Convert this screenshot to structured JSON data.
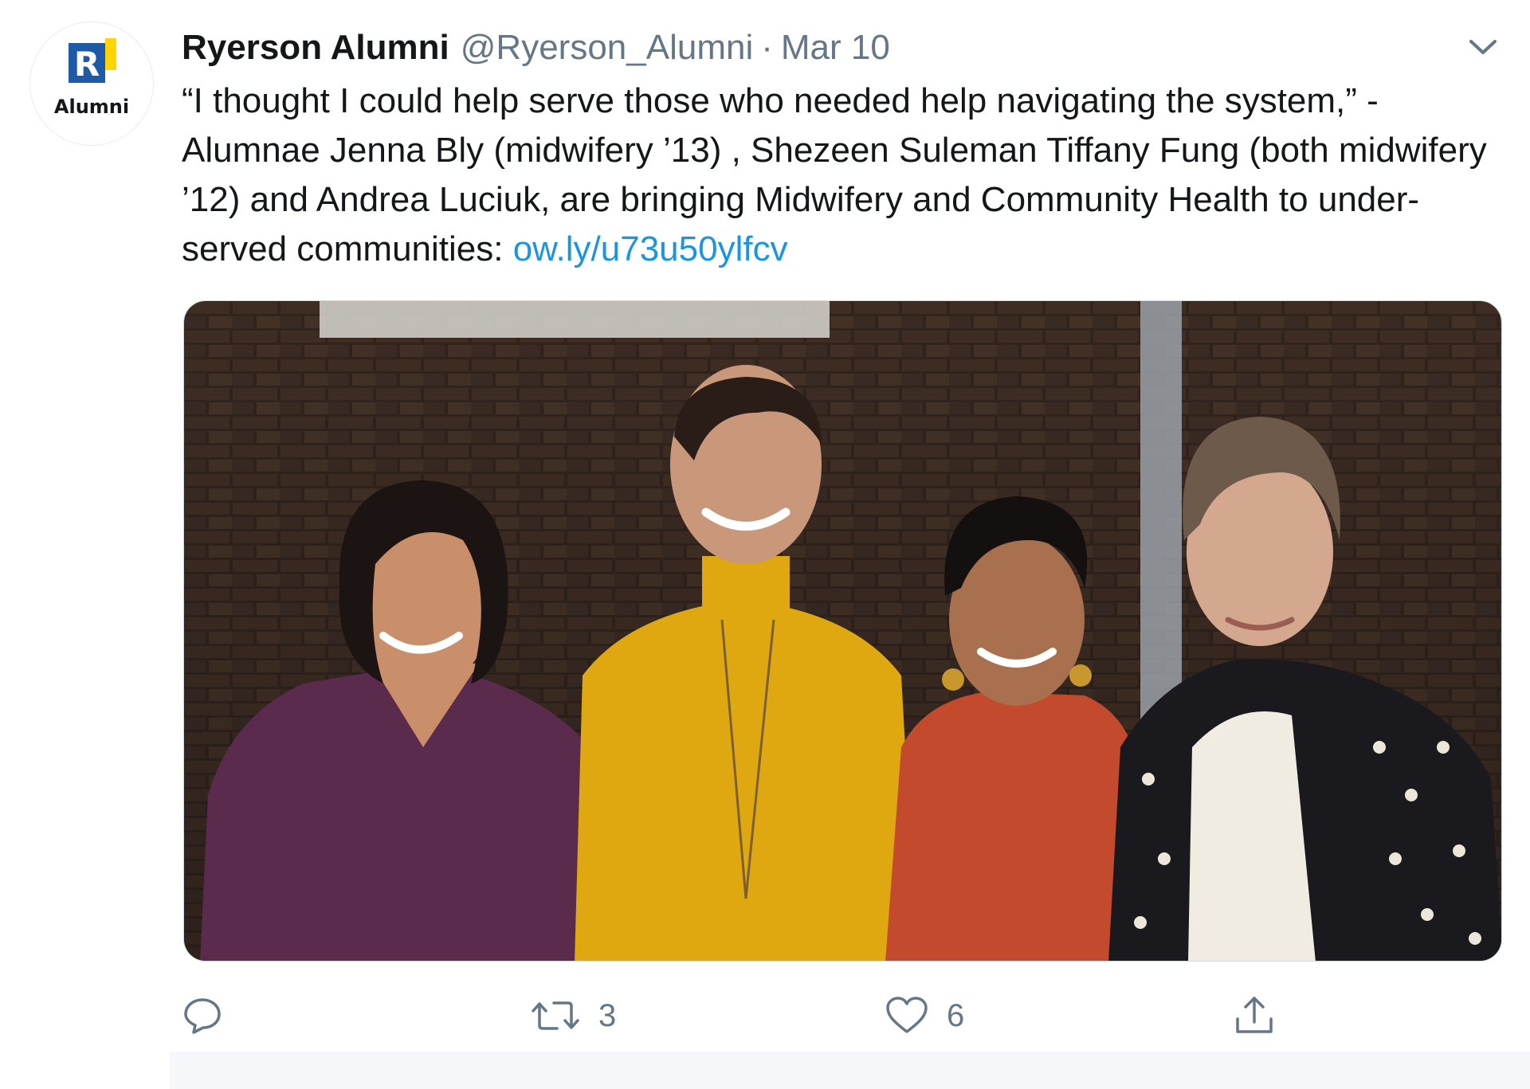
{
  "tweet": {
    "author_name": "Ryerson Alumni",
    "handle": "@Ryerson_Alumni",
    "separator": "·",
    "date": "Mar 10",
    "text": "“I thought I could help serve those who needed help navigating the system,” - Alumnae Jenna Bly (midwifery ’13) , Shezeen Suleman Tiffany Fung (both midwifery ’12) and Andrea Luciuk, are bringing Midwifery and Community Health to under-served communities: ",
    "link_text": "ow.ly/u73u50ylfcv",
    "avatar": {
      "logo_letter": "R",
      "caption": "Alumni",
      "logo_blue": "#1f5aa8",
      "logo_yellow": "#ffd400"
    }
  },
  "actions": {
    "reply": {
      "icon": "reply-icon",
      "count": ""
    },
    "retweet": {
      "icon": "retweet-icon",
      "count": "3"
    },
    "like": {
      "icon": "heart-icon",
      "count": "6"
    },
    "share": {
      "icon": "share-icon",
      "count": ""
    }
  },
  "colors": {
    "text_primary": "#14171a",
    "text_secondary": "#657786",
    "link": "#1b95e0",
    "border": "#cfd9de"
  }
}
